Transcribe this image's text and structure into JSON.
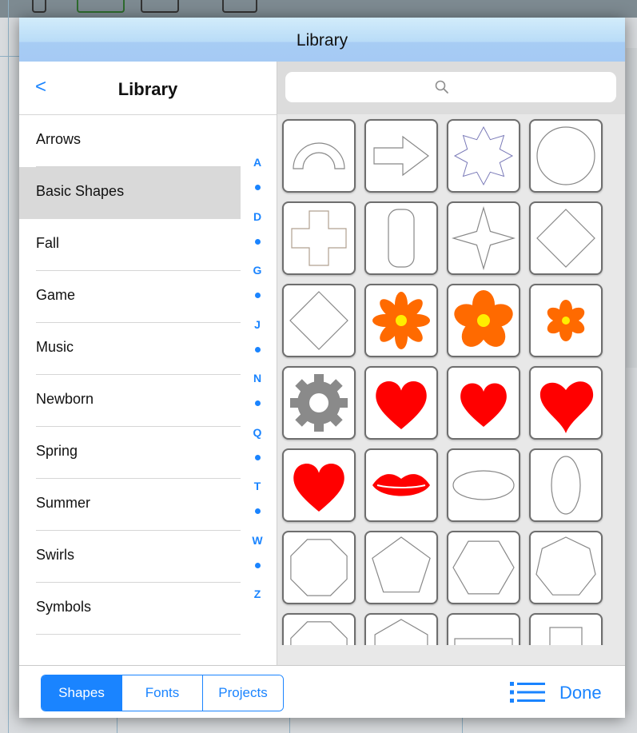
{
  "modal": {
    "title": "Library"
  },
  "nav": {
    "back_label": "<",
    "title": "Library"
  },
  "categories": [
    {
      "label": "Arrows",
      "selected": false
    },
    {
      "label": "Basic Shapes",
      "selected": true
    },
    {
      "label": "Fall",
      "selected": false
    },
    {
      "label": "Game",
      "selected": false
    },
    {
      "label": "Music",
      "selected": false
    },
    {
      "label": "Newborn",
      "selected": false
    },
    {
      "label": "Spring",
      "selected": false
    },
    {
      "label": "Summer",
      "selected": false
    },
    {
      "label": "Swirls",
      "selected": false
    },
    {
      "label": "Symbols",
      "selected": false
    }
  ],
  "index_letters": [
    "A",
    "D",
    "G",
    "J",
    "N",
    "Q",
    "T",
    "W",
    "Z"
  ],
  "search": {
    "placeholder": "",
    "icon": "search-icon"
  },
  "shapes": [
    "arch",
    "arrow-right",
    "asterisk-star",
    "circle",
    "cross",
    "rounded-rectangle-vertical",
    "four-point-star",
    "diamond",
    "diamond",
    "flower-8-petal",
    "flower-5-petal",
    "flower-small",
    "gear",
    "heart",
    "heart-rounded",
    "heart-curled",
    "heart",
    "lips",
    "ellipse-horizontal",
    "ellipse-vertical",
    "octagon",
    "pentagon",
    "hexagon",
    "heptagon",
    "octagon-partial",
    "hexagon-partial",
    "rectangle-partial",
    "square-partial"
  ],
  "bottom": {
    "tabs": [
      {
        "label": "Shapes",
        "active": true
      },
      {
        "label": "Fonts",
        "active": false
      },
      {
        "label": "Projects",
        "active": false
      }
    ],
    "list_icon": "list-icon",
    "done_label": "Done"
  },
  "colors": {
    "accent": "#1a84ff",
    "shape_red": "#ff0000",
    "flower_orange": "#ff6a00",
    "flower_center": "#ffee00",
    "gear_gray": "#8a8a8a"
  }
}
